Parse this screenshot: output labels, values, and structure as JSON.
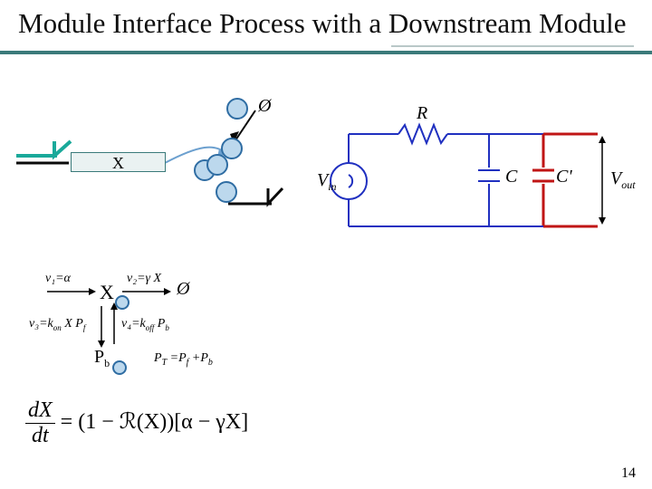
{
  "title": "Module Interface Process with a Downstream Module",
  "page_number": "14",
  "glyphs": {
    "phi": "Ø",
    "R": "R",
    "Vin": "V",
    "Vin_sub": "in",
    "C": "C",
    "Cprime": "C'",
    "Vout": "V",
    "Vout_sub": "out",
    "X": "X",
    "x_upper": "X",
    "Pb": "P",
    "Pb_sub": "b",
    "v1": "v₁=α",
    "v2": "v₂=γ X",
    "v3": "v₃=k",
    "v3_on": "on",
    "v3_tail": " X P",
    "v3_f": "f",
    "v4": "v₄=k",
    "v4_off": "off",
    "v4_tail": " P",
    "v4_b": "b",
    "PT": "P",
    "PT_sub": "T",
    "PT_eq": " =P",
    "PT_f": "f",
    "PT_plus": " +P",
    "PT_b": "b"
  },
  "equation": {
    "frac_top": "dX",
    "frac_bot": "dt",
    "body": " = (1 − ℛ(X))[α − γX]"
  }
}
